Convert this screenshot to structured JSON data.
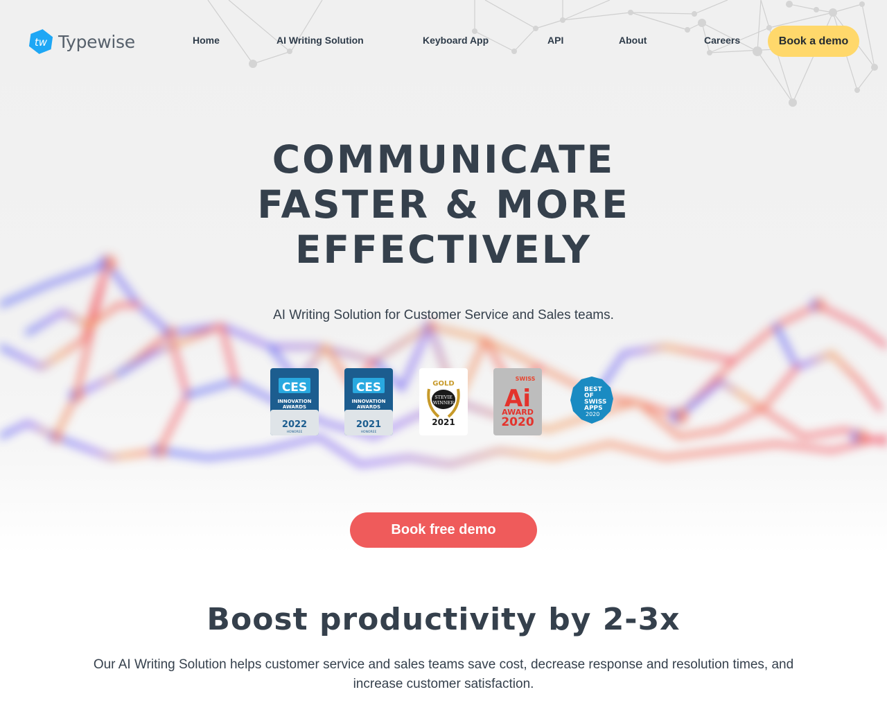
{
  "brand": {
    "name": "Typewise",
    "logo_glyph": "tw",
    "logo_color": "#1ea7f5"
  },
  "nav": {
    "items": [
      {
        "label": "Home"
      },
      {
        "label": "AI Writing Solution"
      },
      {
        "label": "Keyboard App"
      },
      {
        "label": "API"
      },
      {
        "label": "About"
      },
      {
        "label": "Careers"
      }
    ],
    "cta_label": "Book a demo",
    "cta_color": "#ffd86b"
  },
  "hero": {
    "title_lines": [
      "COMMUNICATE",
      "FASTER & MORE",
      "EFFECTIVELY"
    ],
    "subtitle": "AI Writing Solution for Customer Service and Sales teams.",
    "cta_label": "Book free demo",
    "cta_color": "#ef5b5b"
  },
  "badges": [
    {
      "name": "ces-2022",
      "top": "CES",
      "line1": "INNOVATION",
      "line2": "AWARDS",
      "year": "2022",
      "note": "HONOREE"
    },
    {
      "name": "ces-2021",
      "top": "CES",
      "line1": "INNOVATION",
      "line2": "AWARDS",
      "year": "2021",
      "note": "HONOREE"
    },
    {
      "name": "stevie-gold",
      "top": "GOLD",
      "line1": "STEVIE",
      "line2": "WINNER",
      "year": "2021"
    },
    {
      "name": "swiss-ai-award",
      "top": "SWISS",
      "line1": "Ai",
      "line2": "AWARD",
      "year": "2020"
    },
    {
      "name": "best-of-swiss-apps",
      "line1": "BEST",
      "line2": "OF",
      "line3": "SWISS",
      "line4": "APPS",
      "year": "2020"
    }
  ],
  "productivity": {
    "title": "Boost productivity by 2-3x",
    "text": "Our AI Writing Solution helps customer service and sales teams save cost, decrease response and resolution times, and increase customer satisfaction."
  }
}
